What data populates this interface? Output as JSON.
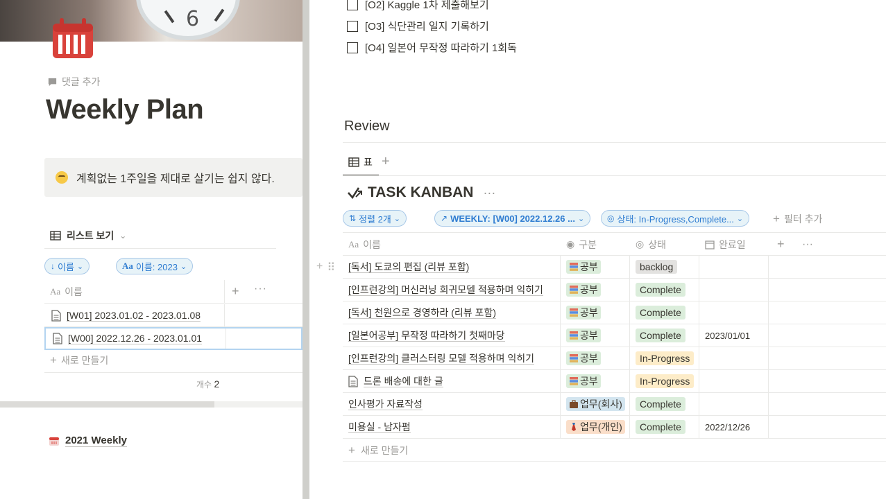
{
  "left": {
    "comment_add": "댓글 추가",
    "title": "Weekly Plan",
    "callout_text": "계획없는 1주일을 제대로 살기는 쉽지 않다.",
    "view_name": "리스트 보기",
    "sort_pill": "이름",
    "filter_pill": "이름: 2023",
    "column_name": "이름",
    "rows": [
      {
        "title": "[W01] 2023.01.02 - 2023.01.08"
      },
      {
        "title": "[W00] 2022.12.26 - 2023.01.01"
      }
    ],
    "new_label": "새로 만들기",
    "count_label": "개수",
    "count_value": "2",
    "weekly_link": "2021 Weekly"
  },
  "right": {
    "todos": [
      {
        "label": "[O2] Kaggle 1차 제출해보기"
      },
      {
        "label": "[O3] 식단관리 일지 기록하기"
      },
      {
        "label": "[O4] 일본어 무작정 따라하기 1회독"
      }
    ],
    "review_heading": "Review",
    "tab_label": "표",
    "db_title": "TASK KANBAN",
    "sort_pill": "정렬 2개",
    "weekly_pill": "WEEKLY: [W00] 2022.12.26 ...",
    "status_pill": "상태: In-Progress,Complete...",
    "filter_add": "필터 추가",
    "columns": {
      "name": "이름",
      "type": "구분",
      "status": "상태",
      "date": "완료일"
    },
    "rows": [
      {
        "name": "[독서] 도쿄의 편집 (리뷰 포함)",
        "type": "공부",
        "status": "backlog",
        "date": ""
      },
      {
        "name": "[인프런강의] 머신러닝 회귀모델 적용하며 익히기",
        "type": "공부",
        "status": "Complete",
        "date": ""
      },
      {
        "name": "[독서] 천원으로 경영하라 (리뷰 포함)",
        "type": "공부",
        "status": "Complete",
        "date": ""
      },
      {
        "name": "[일본어공부] 무작정 따라하기 첫째마당",
        "type": "공부",
        "status": "Complete",
        "date": "2023/01/01"
      },
      {
        "name": "[인프런강의] 클러스터링 모델 적용하며 익히기",
        "type": "공부",
        "status": "In-Progress",
        "date": ""
      },
      {
        "name": "드론 배송에 대한 글",
        "type": "공부",
        "status": "In-Progress",
        "date": ""
      },
      {
        "name": "인사평가 자료작성",
        "type": "업무(회사)",
        "status": "Complete",
        "date": ""
      },
      {
        "name": "미용실 - 남자펌",
        "type": "업무(개인)",
        "status": "Complete",
        "date": "2022/12/26"
      }
    ],
    "new_label": "새로 만들기"
  }
}
